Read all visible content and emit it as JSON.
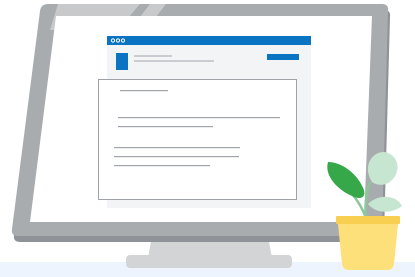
{
  "illustration": {
    "subject": "computer-monitor-with-document-and-potted-plant",
    "colors": {
      "bezel": "#a9acaf",
      "bezel_shadow": "#8f9296",
      "screen": "#ffffff",
      "stand": "#d2d4d6",
      "floor": "#eef4fd",
      "window_titlebar": "#0b74c2",
      "window_body": "#f3f4f5",
      "window_button": "#0b74c2",
      "document_border": "#9ea2a6",
      "text_lines": "#a2a6aa",
      "leaf_dark": "#36a84a",
      "leaf_light": "#c6e6d2",
      "stem": "#8bc79b",
      "pot": "#fde07a",
      "pot_rim": "#f9cf51"
    },
    "window_controls": [
      "dot",
      "dot",
      "dot"
    ]
  }
}
